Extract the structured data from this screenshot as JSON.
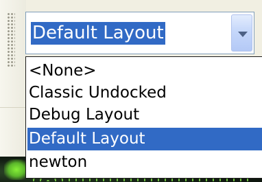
{
  "combo": {
    "selected_value": "Default Layout",
    "button_icon": "chevron-down-icon"
  },
  "dropdown": {
    "options": [
      {
        "label": "<None>",
        "selected": false
      },
      {
        "label": "Classic Undocked",
        "selected": false
      },
      {
        "label": "Debug Layout",
        "selected": false
      },
      {
        "label": "Default Layout",
        "selected": true
      },
      {
        "label": "newton",
        "selected": false
      }
    ]
  },
  "colors": {
    "selection": "#316ac5",
    "combo_border": "#7f9db9",
    "combo_button": "#c5d7fa",
    "list_border": "#1a1a1a",
    "background": "#f1efe2"
  }
}
